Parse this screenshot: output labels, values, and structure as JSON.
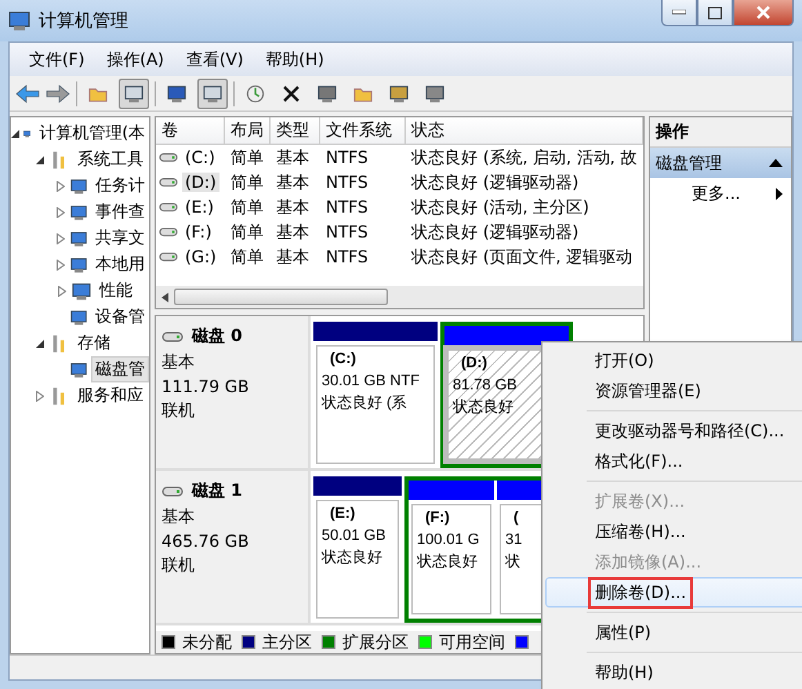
{
  "window": {
    "title": "计算机管理"
  },
  "menu_bar": [
    "文件(F)",
    "操作(A)",
    "查看(V)",
    "帮助(H)"
  ],
  "tree": [
    {
      "label": "计算机管理(本",
      "selected": false,
      "expanded": true,
      "children": [
        {
          "label": "系统工具",
          "selected": false,
          "expanded": true,
          "children": [
            {
              "label": "任务计",
              "selected": false,
              "expanded": false
            },
            {
              "label": "事件查",
              "selected": false,
              "expanded": false
            },
            {
              "label": "共享文",
              "selected": false,
              "expanded": false
            },
            {
              "label": "本地用",
              "selected": false,
              "expanded": false
            },
            {
              "label": "性能",
              "selected": false,
              "expanded": false
            },
            {
              "label": "设备管",
              "selected": false
            }
          ]
        },
        {
          "label": "存储",
          "selected": false,
          "expanded": true,
          "children": [
            {
              "label": "磁盘管",
              "selected": true
            }
          ]
        },
        {
          "label": "服务和应",
          "selected": false,
          "expanded": false
        }
      ]
    }
  ],
  "table": {
    "columns": [
      "卷",
      "布局",
      "类型",
      "文件系统",
      "状态"
    ],
    "rows": [
      {
        "cells": [
          "(C:)",
          "简单",
          "基本",
          "NTFS",
          "状态良好 (系统, 启动, 活动, 故"
        ],
        "selected": false
      },
      {
        "cells": [
          "(D:)",
          "简单",
          "基本",
          "NTFS",
          "状态良好 (逻辑驱动器)"
        ],
        "selected": true
      },
      {
        "cells": [
          "(E:)",
          "简单",
          "基本",
          "NTFS",
          "状态良好 (活动, 主分区)"
        ],
        "selected": false
      },
      {
        "cells": [
          "(F:)",
          "简单",
          "基本",
          "NTFS",
          "状态良好 (逻辑驱动器)"
        ],
        "selected": false
      },
      {
        "cells": [
          "(G:)",
          "简单",
          "基本",
          "NTFS",
          "状态良好 (页面文件, 逻辑驱动"
        ],
        "selected": false
      }
    ]
  },
  "disks": [
    {
      "name": "磁盘 0",
      "type": "基本",
      "size": "111.79 GB",
      "status": "联机",
      "partitions": [
        {
          "kind": "primary",
          "label": "(C:)",
          "size": "30.01 GB NTF",
          "status": "状态良好 (系",
          "selected": false
        },
        {
          "kind": "extended",
          "children": [
            {
              "kind": "logical",
              "label": "(D:)",
              "size": "81.78 GB",
              "status": "状态良好",
              "selected": true
            }
          ]
        }
      ]
    },
    {
      "name": "磁盘 1",
      "type": "基本",
      "size": "465.76 GB",
      "status": "联机",
      "partitions": [
        {
          "kind": "primary",
          "label": "(E:)",
          "size": "50.01 GB",
          "status": "状态良好",
          "selected": false
        },
        {
          "kind": "extended",
          "children": [
            {
              "kind": "logical",
              "label": "(F:)",
              "size": "100.01 G",
              "status": "状态良好",
              "selected": false
            },
            {
              "kind": "logical",
              "label": "(",
              "size": "31",
              "status": "状",
              "selected": false
            }
          ]
        }
      ]
    }
  ],
  "legend": [
    {
      "label": "未分配",
      "color": "#000000"
    },
    {
      "label": "主分区",
      "color": "#000080"
    },
    {
      "label": "扩展分区",
      "color": "#008000"
    },
    {
      "label": "可用空间",
      "color": "#00ff00"
    },
    {
      "color": "#0000ff"
    }
  ],
  "actions": {
    "title": "操作",
    "section": "磁盘管理",
    "expanded": true,
    "items": [
      "更多..."
    ]
  },
  "context_menu": [
    {
      "kind": "item",
      "label": "打开(O)",
      "disabled": false,
      "highlighted": false,
      "outlined": false
    },
    {
      "kind": "item",
      "label": "资源管理器(E)",
      "disabled": false,
      "highlighted": false,
      "outlined": false
    },
    {
      "kind": "separator"
    },
    {
      "kind": "item",
      "label": "更改驱动器号和路径(C)...",
      "disabled": false,
      "highlighted": false,
      "outlined": false
    },
    {
      "kind": "item",
      "label": "格式化(F)...",
      "disabled": false,
      "highlighted": false,
      "outlined": false
    },
    {
      "kind": "separator"
    },
    {
      "kind": "item",
      "label": "扩展卷(X)...",
      "disabled": true,
      "highlighted": false,
      "outlined": false
    },
    {
      "kind": "item",
      "label": "压缩卷(H)...",
      "disabled": false,
      "highlighted": false,
      "outlined": false
    },
    {
      "kind": "item",
      "label": "添加镜像(A)...",
      "disabled": true,
      "highlighted": false,
      "outlined": false
    },
    {
      "kind": "item",
      "label": "删除卷(D)...",
      "disabled": false,
      "highlighted": true,
      "outlined": true
    },
    {
      "kind": "separator"
    },
    {
      "kind": "item",
      "label": "属性(P)",
      "disabled": false,
      "highlighted": false,
      "outlined": false
    },
    {
      "kind": "separator"
    },
    {
      "kind": "item",
      "label": "帮助(H)",
      "disabled": false,
      "highlighted": false,
      "outlined": false
    }
  ]
}
